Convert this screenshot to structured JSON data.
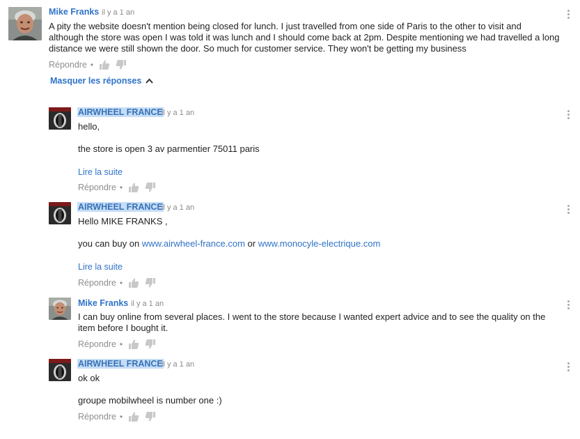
{
  "comment": {
    "author": "Mike Franks",
    "time": "il y a 1 an",
    "text_lines": [
      "A pity the website doesn't mention being closed for lunch.  I just travelled from one side of Paris to the other to visit and",
      "although the store was open I was told it was lunch and I should come back at 2pm. Despite mentioning we had travelled a long",
      "distance we were still shown the door.   So much for customer service.  They won't be getting my business"
    ],
    "reply_label": "Répondre",
    "separator": "•"
  },
  "hide_replies_label": "Masquer les réponses",
  "replies": [
    {
      "author": "AIRWHEEL FRANCE",
      "time": "il y a 1 an",
      "line1": "hello,",
      "line2": "the store is open 3 av parmentier 75011 paris",
      "read_more": "Lire la suite",
      "reply_label": "Répondre",
      "separator": "•"
    },
    {
      "author": "AIRWHEEL FRANCE",
      "time": "il y a 1 an",
      "line1": "Hello MIKE FRANKS ,",
      "line2_prefix": "you can buy on ",
      "link1": "www.airwheel-france.com",
      "line2_mid": " or ",
      "link2": "www.monocyle-electrique.com",
      "read_more": "Lire la suite",
      "reply_label": "Répondre",
      "separator": "•"
    },
    {
      "author": "Mike Franks",
      "time": "il y a 1 an",
      "line1": "I can buy online from several places.  I went to the store because I wanted expert advice and to see the quality on the",
      "line2": "item before I bought it.",
      "reply_label": "Répondre",
      "separator": "•"
    },
    {
      "author": "AIRWHEEL FRANCE",
      "time": "il y a 1 an",
      "line1": "ok  ok",
      "line2": "groupe mobilwheel is number one :)",
      "reply_label": "Répondre",
      "separator": "•"
    }
  ],
  "icons": {
    "like": "thumbs-up-icon",
    "dislike": "thumbs-down-icon",
    "menu": "more-vert-icon",
    "chevron": "chevron-up-icon"
  }
}
